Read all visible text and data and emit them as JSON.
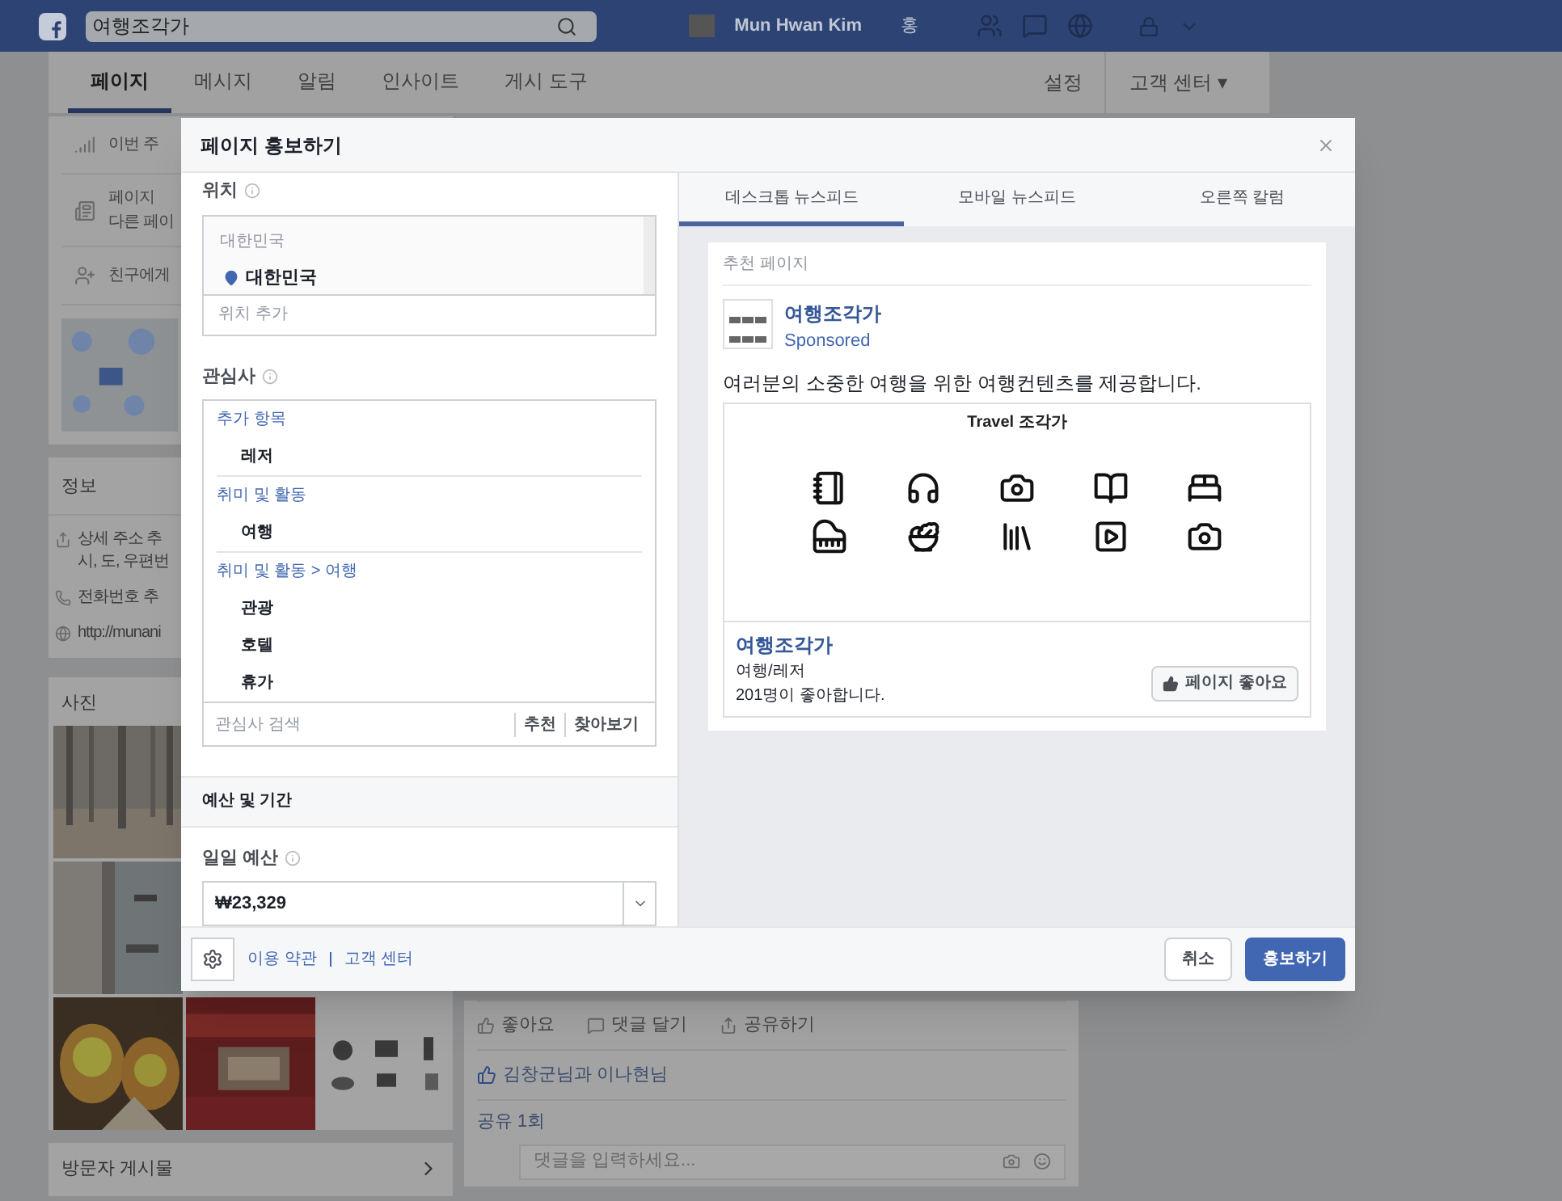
{
  "topbar": {
    "search_value": "여행조각가",
    "user_name": "Mun Hwan Kim",
    "user_short": "홍"
  },
  "page_nav": {
    "tabs": [
      {
        "label": "페이지",
        "selected": true
      },
      {
        "label": "메시지",
        "selected": false
      },
      {
        "label": "알림",
        "selected": false
      },
      {
        "label": "인사이트",
        "selected": false
      },
      {
        "label": "게시 도구",
        "selected": false
      }
    ],
    "settings": "설정",
    "help": "고객 센터 ▾"
  },
  "left_column": {
    "activity": [
      {
        "kind": "chart",
        "lines": [
          "이번 주"
        ]
      },
      {
        "kind": "page",
        "lines": [
          "페이지",
          "다른 페이"
        ]
      },
      {
        "kind": "invite",
        "lines": [
          "친구에게"
        ]
      }
    ],
    "info": {
      "title": "정보",
      "items": [
        {
          "kind": "address",
          "lines": [
            "상세 주소 추",
            "시, 도, 우편번"
          ]
        },
        {
          "kind": "phone",
          "lines": [
            "전화번호 추"
          ]
        },
        {
          "kind": "web",
          "lines": [
            "http://munani"
          ]
        }
      ]
    },
    "photos": {
      "title": "사진"
    },
    "visitor_posts": {
      "title": "방문자 게시물"
    }
  },
  "post": {
    "actions": [
      "좋아요",
      "댓글 달기",
      "공유하기"
    ],
    "likes": "김창군님과 이나현님",
    "shares": "공유 1회",
    "comment_placeholder": "댓글을 입력하세요..."
  },
  "modal": {
    "title": "페이지 홍보하기",
    "location": {
      "label": "위치",
      "header": "대한민국",
      "selected": "대한민국",
      "placeholder": "위치 추가"
    },
    "interests": {
      "label": "관심사",
      "groups": [
        {
          "heading": "추가 항목",
          "items": [
            "레저"
          ]
        },
        {
          "heading": "취미 및 활동",
          "items": [
            "여행"
          ]
        },
        {
          "heading": "취미 및 활동 > 여행",
          "items": [
            "관광",
            "호텔",
            "휴가"
          ]
        }
      ],
      "search_placeholder": "관심사 검색",
      "links": [
        "추천",
        "찾아보기"
      ]
    },
    "budget_section": "예산 및 기간",
    "daily_budget": {
      "label": "일일 예산",
      "value": "₩23,329"
    },
    "footer_links": [
      "이용 약관",
      "고객 센터"
    ],
    "buttons": [
      {
        "label": "취소",
        "kind": "secondary"
      },
      {
        "label": "홍보하기",
        "kind": "primary"
      }
    ],
    "preview_tabs": [
      {
        "label": "데스크톱 뉴스피드",
        "selected": true
      },
      {
        "label": "모바일 뉴스피드",
        "selected": false
      },
      {
        "label": "오른쪽 칼럼",
        "selected": false
      }
    ],
    "preview": {
      "header": "추천 페이지",
      "page_name": "여행조각가",
      "sponsored": "Sponsored",
      "text": "여러분의 소중한 여행을 위한 여행컨텐츠를 제공합니다.",
      "image_title": "Travel 조각가",
      "footer_name": "여행조각가",
      "category": "여행/레저",
      "likes": "201명이 좋아합니다.",
      "like_button": "페이지 좋아요"
    }
  }
}
